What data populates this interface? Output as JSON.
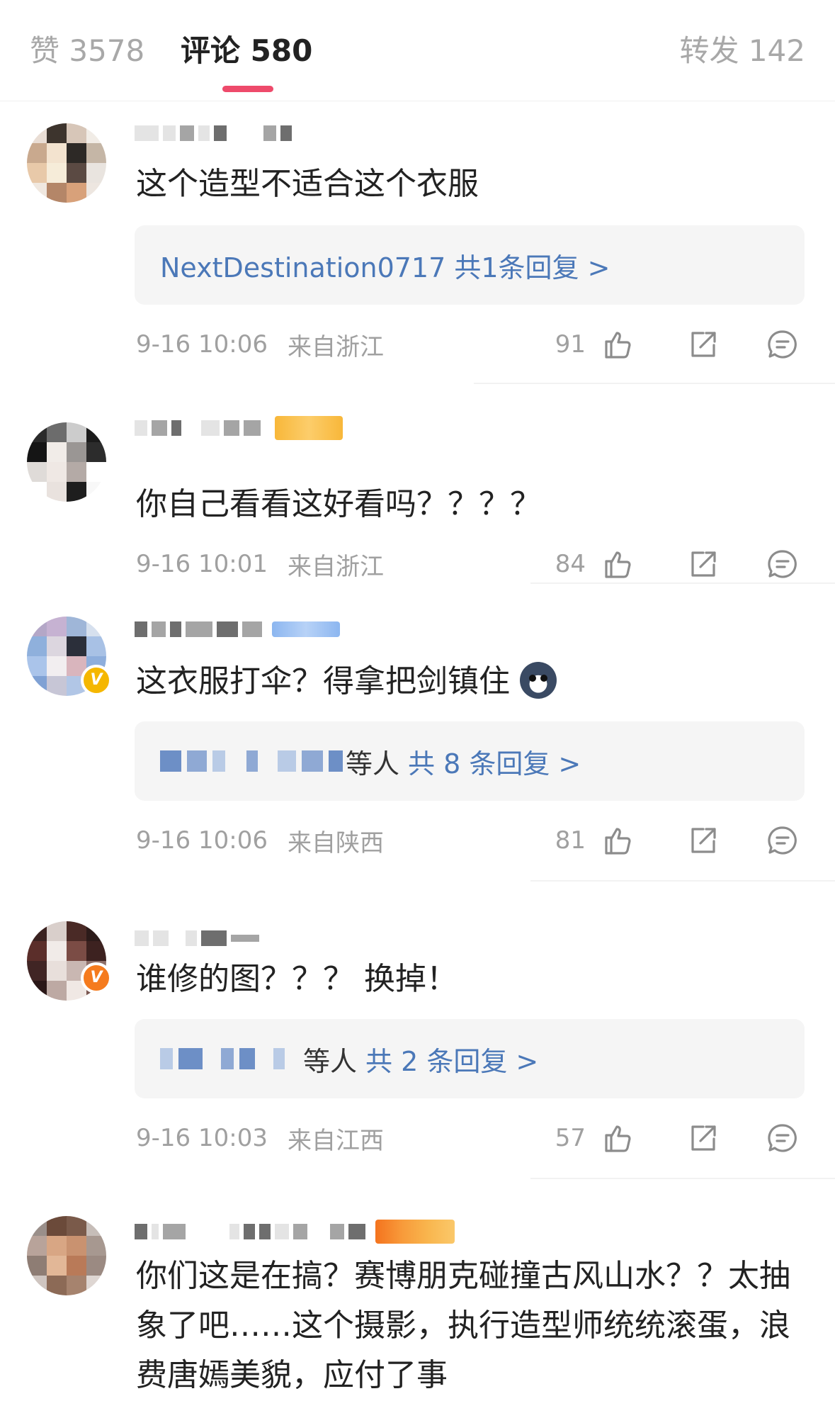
{
  "tabs": {
    "likes": "赞 3578",
    "comments": "评论 580",
    "reposts": "转发 142"
  },
  "colors": {
    "accent": "#ee4a6b",
    "link": "#4b78b8",
    "meta": "#a0a0a0",
    "reply_bg": "#f5f5f5"
  },
  "icons": {
    "like": "thumb-up-icon",
    "share": "share-icon",
    "reply": "comment-icon",
    "verified": "verified-v-icon"
  },
  "comments": [
    {
      "text": "这个造型不适合这个衣服",
      "reply_summary": "NextDestination0717 共1条回复 >",
      "time": "9-16 10:06",
      "location": "来自浙江",
      "likes": "91"
    },
    {
      "text": "你自己看看这好看吗？？？？",
      "time": "9-16 10:01",
      "location": "来自浙江",
      "likes": "84"
    },
    {
      "text": "这衣服打伞？得拿把剑镇住",
      "reply_suffix": "等人",
      "reply_summary": "共 8 条回复 >",
      "time": "9-16 10:06",
      "location": "来自陕西",
      "likes": "81",
      "verified": "V"
    },
    {
      "text": "谁修的图？？？ 换掉！",
      "reply_suffix": "等人",
      "reply_summary": "共 2 条回复 >",
      "time": "9-16 10:03",
      "location": "来自江西",
      "likes": "57",
      "verified": "V"
    },
    {
      "text": "你们这是在搞？赛博朋克碰撞古风山水？？太抽象了吧……这个摄影，执行造型师统统滚蛋，浪费唐嫣美貌，应付了事"
    }
  ]
}
